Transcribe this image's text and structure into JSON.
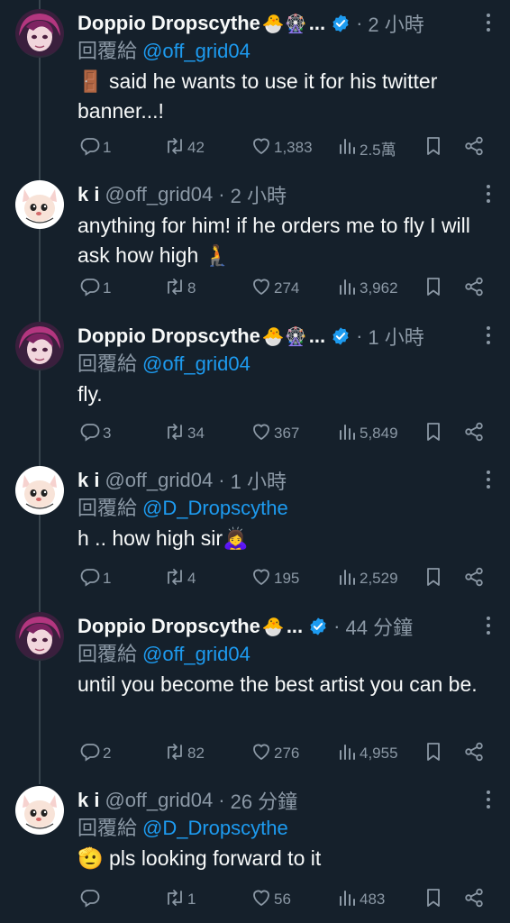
{
  "reply_prefix": "回覆給",
  "tweets": [
    {
      "name": "Doppio Dropscythe",
      "name_emoji": "🐣🎡",
      "name_ellipsis": "...",
      "verified": true,
      "handle": "",
      "time": "2 小時",
      "reply_to": "@off_grid04",
      "text_emoji": "🚪",
      "text": " said he wants to use it for his twitter banner...!",
      "replies": "1",
      "retweets": "42",
      "likes": "1,383",
      "views": "2.5萬",
      "avatar": "doppio"
    },
    {
      "name": "k i",
      "name_emoji": "",
      "name_ellipsis": "",
      "verified": false,
      "handle": "@off_grid04",
      "time": "2 小時",
      "reply_to": "",
      "text_emoji": "",
      "text": "anything for him! if he orders me to fly I will ask how high 🧎",
      "replies": "1",
      "retweets": "8",
      "likes": "274",
      "views": "3,962",
      "avatar": "ki"
    },
    {
      "name": "Doppio Dropscythe",
      "name_emoji": "🐣🎡",
      "name_ellipsis": "...",
      "verified": true,
      "handle": "",
      "time": "1 小時",
      "reply_to": "@off_grid04",
      "text_emoji": "",
      "text": "fly.",
      "replies": "3",
      "retweets": "34",
      "likes": "367",
      "views": "5,849",
      "avatar": "doppio"
    },
    {
      "name": "k i",
      "name_emoji": "",
      "name_ellipsis": "",
      "verified": false,
      "handle": "@off_grid04",
      "time": "1 小時",
      "reply_to": "@D_Dropscythe",
      "text_emoji": "",
      "text": "h .. how high sir🙇‍♀️",
      "replies": "1",
      "retweets": "4",
      "likes": "195",
      "views": "2,529",
      "avatar": "ki"
    },
    {
      "name": "Doppio Dropscythe",
      "name_emoji": "🐣",
      "name_ellipsis": "...",
      "verified": true,
      "handle": "",
      "time": "44 分鐘",
      "reply_to": "@off_grid04",
      "text_emoji": "",
      "text": "until you become the best artist you can be.",
      "replies": "2",
      "retweets": "82",
      "likes": "276",
      "views": "4,955",
      "avatar": "doppio"
    },
    {
      "name": "k i",
      "name_emoji": "",
      "name_ellipsis": "",
      "verified": false,
      "handle": "@off_grid04",
      "time": "26 分鐘",
      "reply_to": "@D_Dropscythe",
      "text_emoji": "🫡",
      "text": " pls looking forward to it",
      "replies": "",
      "retweets": "1",
      "likes": "56",
      "views": "483",
      "avatar": "ki"
    }
  ],
  "colors": {
    "background": "#15202b",
    "text": "#f7f9f9",
    "muted": "#8b98a5",
    "accent": "#1d9bf0",
    "thread_line": "#38444d"
  },
  "icons": {
    "reply": "reply-icon",
    "retweet": "retweet-icon",
    "like": "heart-icon",
    "views": "views-chart-icon",
    "bookmark": "bookmark-icon",
    "share": "share-icon",
    "more": "more-dots-icon",
    "verified": "verified-badge-icon"
  }
}
